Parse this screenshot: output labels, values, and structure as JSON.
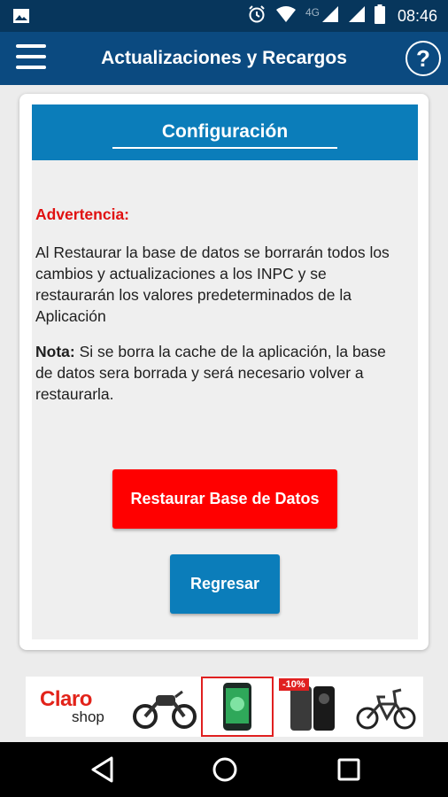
{
  "status_bar": {
    "time": "08:46",
    "network": "4G",
    "icons": [
      "image-icon",
      "alarm-icon",
      "wifi-icon",
      "signal-icon",
      "battery-icon"
    ]
  },
  "app_bar": {
    "title": "Actualizaciones y Recargos",
    "menu_icon": "hamburger-menu-icon",
    "help_label": "?",
    "color": "#0b4a80"
  },
  "config": {
    "header_title": "Configuración",
    "header_color": "#0b7dba",
    "warning_title": "Advertencia:",
    "warning_text": "Al Restaurar la base de datos se borrarán todos los cambios y actualizaciones a los INPC y se restaurarán los valores predeterminados de la Aplicación",
    "note_label": "Nota:",
    "note_text": " Si se borra la cache de la aplicación, la base de datos sera borrada y será necesario volver a restaurarla.",
    "restore_button": "Restaurar Base de Datos",
    "restore_color": "#ff0000",
    "back_button": "Regresar"
  },
  "ad": {
    "brand_top": "Claro",
    "brand_bottom": "shop",
    "discount": "-10%",
    "products": [
      "motorcycle",
      "smartphone",
      "smartphone-pair",
      "electric-bicycle"
    ]
  },
  "nav": {
    "icons": [
      "back-icon",
      "home-icon",
      "recents-icon"
    ]
  }
}
